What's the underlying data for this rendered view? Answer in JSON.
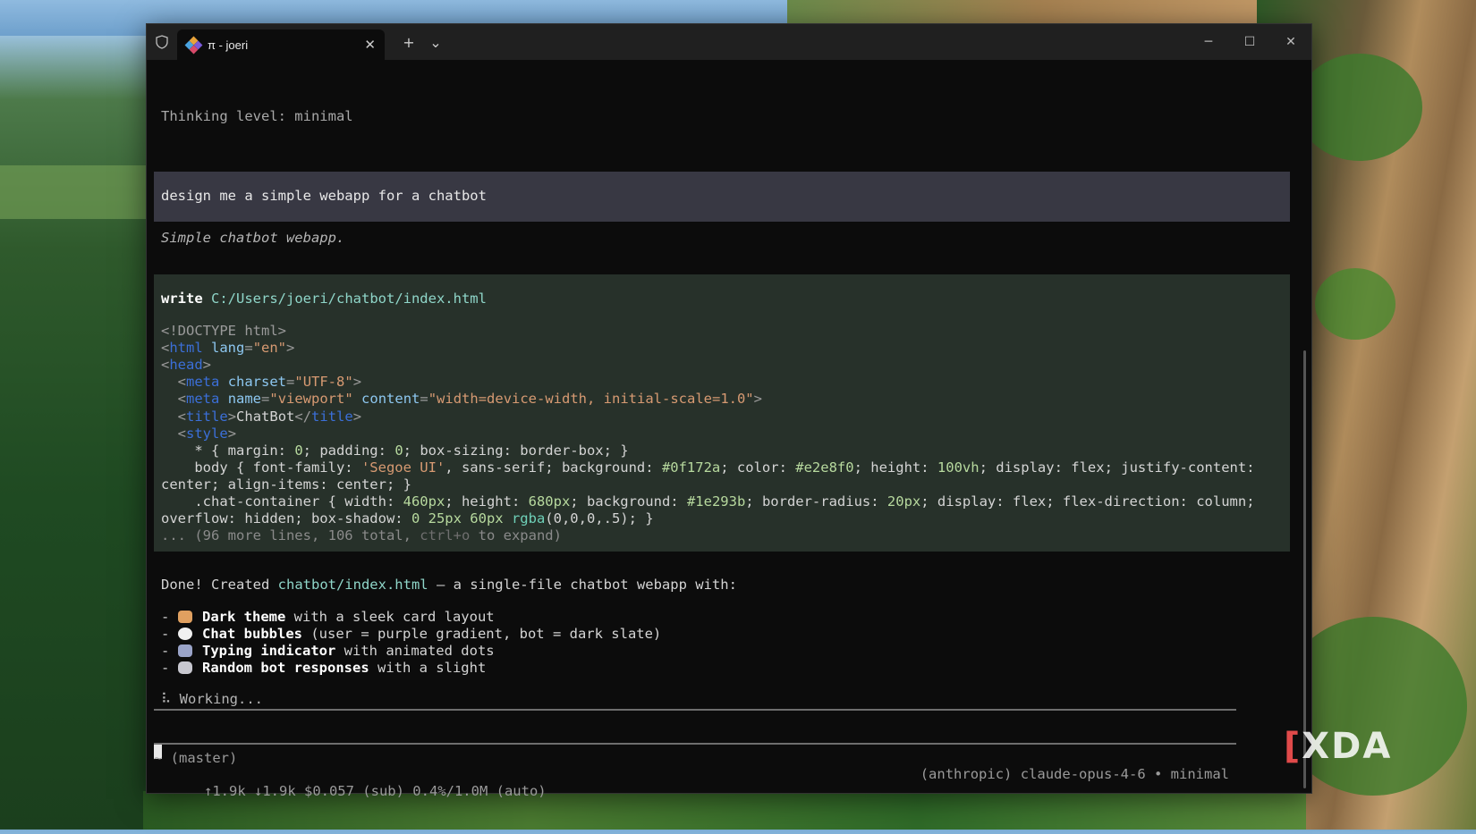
{
  "window": {
    "tab_title": "π - joeri",
    "new_tab_label": "+",
    "dropdown_label": "⌄",
    "close_tab_label": "✕",
    "minimize_label": "─",
    "maximize_label": "☐",
    "close_label": "✕"
  },
  "terminal": {
    "thinking": "Thinking level: minimal",
    "user_prompt": "design me a simple webapp for a chatbot",
    "assistant_summary": "Simple chatbot webapp.",
    "tool": {
      "command": "write",
      "path": "C:/Users/joeri/chatbot/index.html",
      "lines": [
        "<!DOCTYPE html>",
        "<html lang=\"en\">",
        "<head>",
        "  <meta charset=\"UTF-8\">",
        "  <meta name=\"viewport\" content=\"width=device-width, initial-scale=1.0\">",
        "  <title>ChatBot</title>",
        "  <style>",
        "    * { margin: 0; padding: 0; box-sizing: border-box; }",
        "    body { font-family: 'Segoe UI', sans-serif; background: #0f172a; color: #e2e8f0; height: 100vh; display: flex; justify-content:",
        "center; align-items: center; }",
        "    .chat-container { width: 460px; height: 680px; background: #1e293b; border-radius: 20px; display: flex; flex-direction: column;",
        "overflow: hidden; box-shadow: 0 25px 60px rgba(0,0,0,.5); }"
      ],
      "more_prefix": "... (96 more lines, 106 total, ",
      "more_shortcut": "ctrl+o",
      "more_suffix": " to expand)"
    },
    "done_prefix": "Done! Created ",
    "done_path": "chatbot/index.html",
    "done_suffix": " — a single-file chatbot webapp with:",
    "bullets": [
      {
        "bold": "Dark theme",
        "rest": " with a sleek card layout",
        "emoji_color": "#e0a060"
      },
      {
        "bold": "Chat bubbles",
        "rest": " (user = purple gradient, bot = dark slate)",
        "emoji_color": "#f0f0f0"
      },
      {
        "bold": "Typing indicator",
        "rest": " with animated dots",
        "emoji_color": "#9aa4c8"
      },
      {
        "bold": "Random bot responses",
        "rest": " with a slight",
        "emoji_color": "#c8c8d0"
      }
    ],
    "working": "⠧ Working...",
    "status_cwd": "~ (master)",
    "status_usage": "↑1.9k ↓1.9k $0.057 (sub) 0.4%/1.0M (auto)",
    "status_model": "(anthropic) claude-opus-4-6 • minimal"
  },
  "watermark": {
    "bracket": "[",
    "text": "XDA"
  }
}
